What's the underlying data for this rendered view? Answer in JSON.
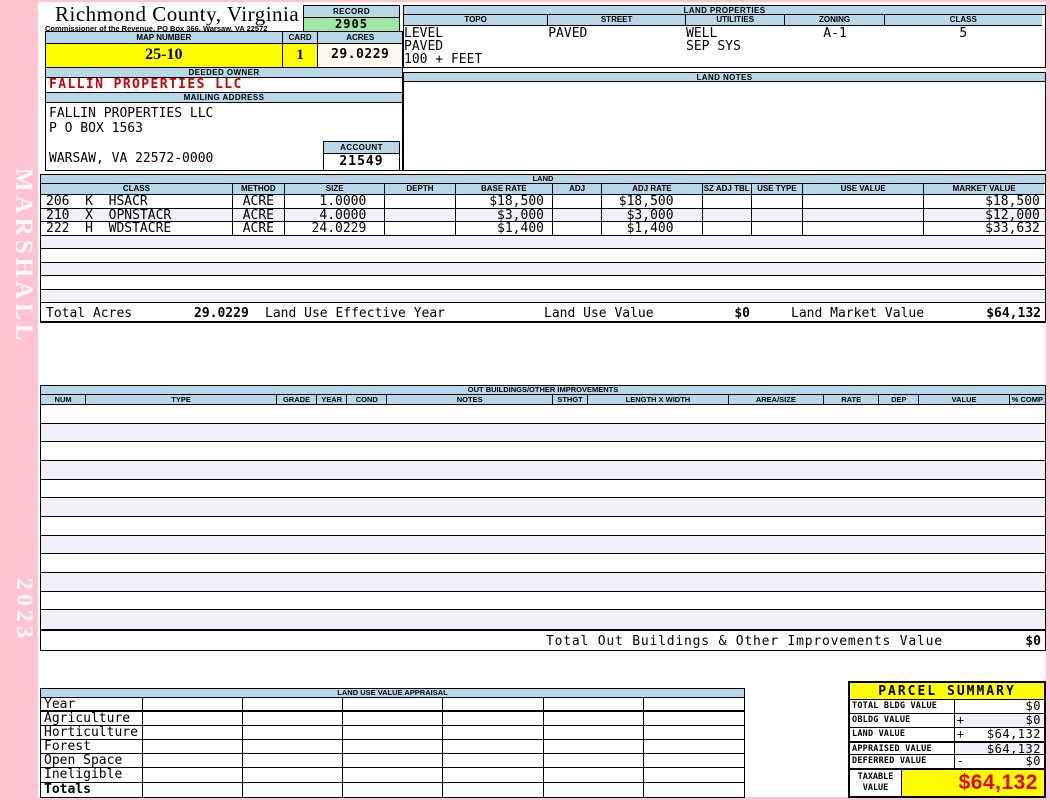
{
  "colors": {
    "background_pink": "#ffc4cf",
    "header_blue": "#b8d7e9",
    "record_green": "#9fe7a4",
    "highlight_yellow": "#ffff00",
    "owner_red": "#cc0000",
    "taxable_red": "#e60000",
    "alt_row": "#f1f1f9",
    "acres_ivory": "#fdfaee"
  },
  "sidebar": {
    "watermark": "MARSHALL",
    "year": "2023"
  },
  "header": {
    "county": "Richmond County, Virginia",
    "sub": "Commissioner of the Revenue, PO Box 366, Warsaw, VA 22572",
    "record_label": "RECORD",
    "record": "2905",
    "map_number_label": "MAP NUMBER",
    "map_number": "25-10",
    "card_label": "CARD",
    "card": "1",
    "acres_label": "ACRES",
    "acres": "29.0229",
    "deeded_owner_label": "DEEDED OWNER",
    "deeded_owner": "FALLIN PROPERTIES LLC",
    "mailing_address_label": "MAILING ADDRESS",
    "mailing_lines": [
      "FALLIN PROPERTIES LLC",
      "P O BOX 1563",
      "",
      "WARSAW, VA 22572-0000"
    ],
    "account_label": "ACCOUNT",
    "account": "21549"
  },
  "land_properties": {
    "title": "LAND PROPERTIES",
    "columns": [
      "TOPO",
      "STREET",
      "UTILITIES",
      "ZONING",
      "CLASS"
    ],
    "topo": [
      "LEVEL",
      "PAVED",
      "100 + FEET"
    ],
    "street": [
      "PAVED"
    ],
    "utilities": [
      "WELL",
      "SEP SYS"
    ],
    "zoning": [
      "A-1"
    ],
    "class": [
      "5"
    ]
  },
  "land_notes": {
    "title": "LAND NOTES",
    "text": ""
  },
  "land": {
    "title": "LAND",
    "columns": [
      "CLASS",
      "METHOD",
      "SIZE",
      "DEPTH",
      "BASE RATE",
      "ADJ",
      "ADJ RATE",
      "SZ ADJ TBL",
      "USE TYPE",
      "USE VALUE",
      "MARKET VALUE"
    ],
    "rows": [
      {
        "class": "206  K  HSACR",
        "method": "ACRE",
        "size": "1.0000",
        "depth": "",
        "base_rate": "$18,500",
        "adj": "",
        "adj_rate": "$18,500",
        "sz_adj_tbl": "",
        "use_type": "",
        "use_value": "",
        "market_value": "$18,500"
      },
      {
        "class": "210  X  OPNSTACR",
        "method": "ACRE",
        "size": "4.0000",
        "depth": "",
        "base_rate": "$3,000",
        "adj": "",
        "adj_rate": "$3,000",
        "sz_adj_tbl": "",
        "use_type": "",
        "use_value": "",
        "market_value": "$12,000"
      },
      {
        "class": "222  H  WDSTACRE",
        "method": "ACRE",
        "size": "24.0229",
        "depth": "",
        "base_rate": "$1,400",
        "adj": "",
        "adj_rate": "$1,400",
        "sz_adj_tbl": "",
        "use_type": "",
        "use_value": "",
        "market_value": "$33,632"
      }
    ],
    "totals": {
      "total_acres_label": "Total Acres",
      "total_acres": "29.0229",
      "effective_year_label": "Land Use Effective Year",
      "use_value_label": "Land Use Value",
      "use_value": "$0",
      "market_value_label": "Land Market Value",
      "market_value": "$64,132"
    }
  },
  "out_buildings": {
    "title": "OUT BUILDINGS/OTHER IMPROVEMENTS",
    "columns": [
      "NUM",
      "TYPE",
      "GRADE",
      "YEAR",
      "COND",
      "NOTES",
      "STHGT",
      "LENGTH X WIDTH",
      "AREA/SIZE",
      "RATE",
      "DEP",
      "VALUE",
      "% COMP"
    ],
    "total_label": "Total Out Buildings & Other Improvements Value",
    "total_value": "$0"
  },
  "land_use_appraisal": {
    "title": "LAND USE VALUE APPRAISAL",
    "row_labels": [
      "Year",
      "Agriculture",
      "Horticulture",
      "Forest",
      "Open Space",
      "Ineligible",
      "Totals"
    ]
  },
  "parcel_summary": {
    "title": "PARCEL SUMMARY",
    "rows": [
      {
        "label": "TOTAL BLDG VALUE",
        "op": "",
        "value": "$0"
      },
      {
        "label": "OBLDG VALUE",
        "op": "+",
        "value": "$0"
      },
      {
        "label": "LAND VALUE",
        "op": "+",
        "value": "$64,132"
      },
      {
        "label": "APPRAISED VALUE",
        "op": "",
        "value": "$64,132"
      },
      {
        "label": "DEFERRED VALUE",
        "op": "-",
        "value": "$0"
      }
    ],
    "taxable_label": "TAXABLE\nVALUE",
    "taxable_value": "$64,132"
  }
}
